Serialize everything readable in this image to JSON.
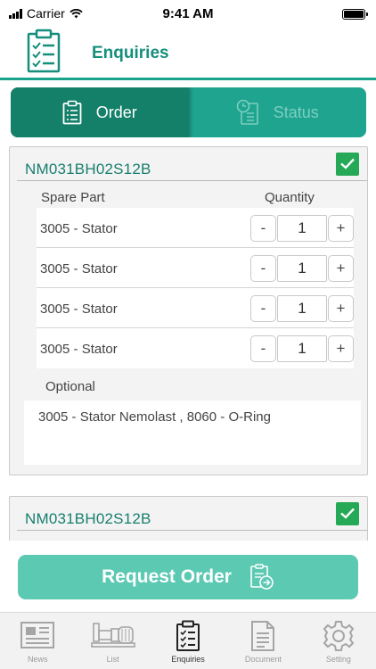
{
  "status_bar": {
    "carrier": "Carrier",
    "time": "9:41 AM"
  },
  "header": {
    "title": "Enquiries",
    "icon": "clipboard-checklist-icon"
  },
  "tabs": [
    {
      "label": "Order",
      "icon": "clipboard-icon",
      "active": true
    },
    {
      "label": "Status",
      "icon": "clock-clipboard-icon",
      "active": false
    }
  ],
  "cards": [
    {
      "code": "NM031BH02S12B",
      "checked": true,
      "column_part": "Spare Part",
      "column_quantity": "Quantity",
      "rows": [
        {
          "name": "3005 - Stator",
          "minus": "-",
          "qty": "1",
          "plus": "+"
        },
        {
          "name": "3005 - Stator",
          "minus": "-",
          "qty": "1",
          "plus": "+"
        },
        {
          "name": "3005 - Stator",
          "minus": "-",
          "qty": "1",
          "plus": "+"
        },
        {
          "name": "3005 - Stator",
          "minus": "-",
          "qty": "1",
          "plus": "+"
        }
      ],
      "optional_label": "Optional",
      "optional_text": "3005 - Stator Nemolast , 8060 - O-Ring"
    },
    {
      "code": "NM031BH02S12B",
      "checked": true
    }
  ],
  "request_button": {
    "label": "Request Order",
    "icon": "order-document-icon"
  },
  "bottom_nav": [
    {
      "label": "News",
      "icon": "newspaper-icon",
      "active": false
    },
    {
      "label": "List",
      "icon": "pump-machine-icon",
      "active": false
    },
    {
      "label": "Enquiries",
      "icon": "clipboard-checklist-icon",
      "active": true
    },
    {
      "label": "Document",
      "icon": "document-icon",
      "active": false
    },
    {
      "label": "Setting",
      "icon": "gear-icon",
      "active": false
    }
  ],
  "colors": {
    "accent": "#1aa38a",
    "accent_dark": "#148069",
    "title": "#158e7c",
    "button": "#5cc9b3",
    "check": "#26a957"
  }
}
